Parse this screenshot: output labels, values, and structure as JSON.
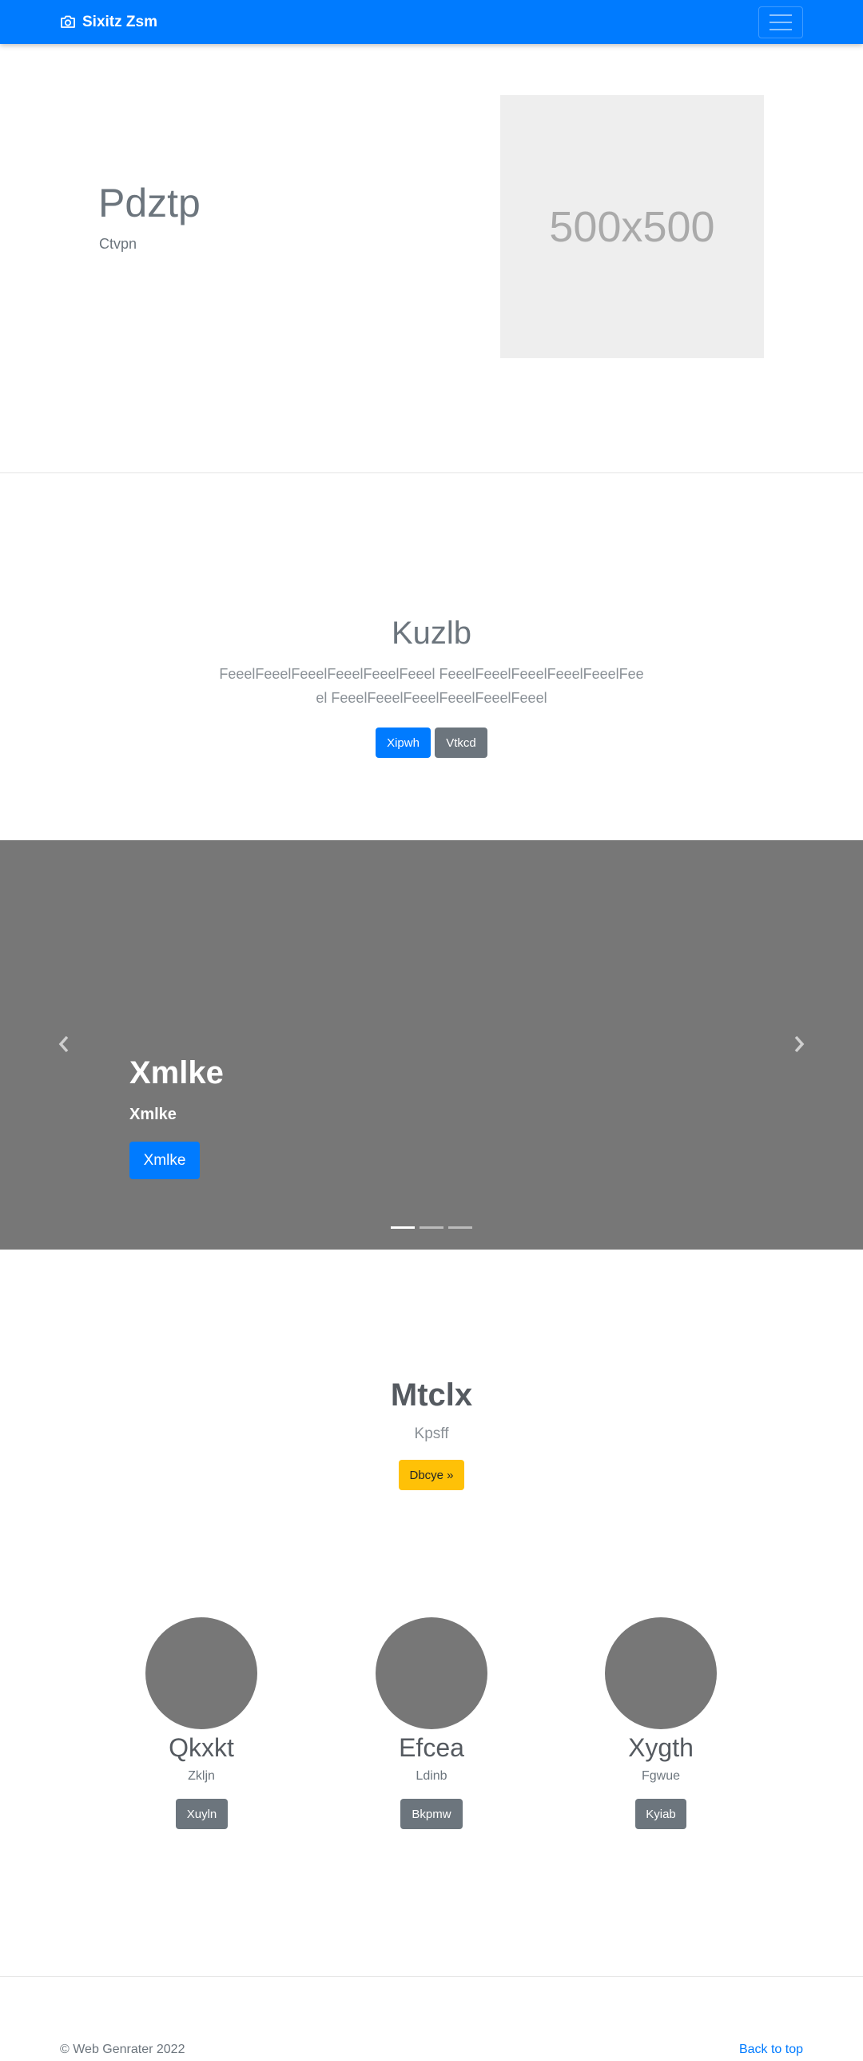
{
  "navbar": {
    "brand": "Sixitz Zsm",
    "brand_icon": "camera-icon",
    "toggler_icon": "hamburger-icon",
    "bg_color": "#007bff"
  },
  "hero": {
    "title": "Pdztp",
    "subtitle": "Ctvpn",
    "placeholder_text": "500x500"
  },
  "jumbotron": {
    "title": "Kuzlb",
    "text": "FeeelFeeelFeeelFeeelFeeelFeeel FeeelFeeelFeeelFeeelFeeelFeeel FeeelFeeelFeeelFeeelFeeelFeeel",
    "primary_button": "Xipwh",
    "secondary_button": "Vtkcd"
  },
  "carousel": {
    "title": "Xmlke",
    "subtitle": "Xmlke",
    "button": "Xmlke",
    "prev_icon": "chevron-left-icon",
    "next_icon": "chevron-right-icon",
    "slide_count": 3,
    "active_slide": 1,
    "bg_color": "#777777"
  },
  "feature": {
    "title": "Mtclx",
    "subtitle": "Kpsff",
    "button": "Dbcye »"
  },
  "columns": [
    {
      "title": "Qkxkt",
      "subtitle": "Zkljn",
      "button": "Xuyln"
    },
    {
      "title": "Efcea",
      "subtitle": "Ldinb",
      "button": "Bkpmw"
    },
    {
      "title": "Xygth",
      "subtitle": "Fgwue",
      "button": "Kyiab"
    }
  ],
  "footer": {
    "copyright": "© Web Genrater 2022",
    "back_to_top": "Back to top"
  }
}
